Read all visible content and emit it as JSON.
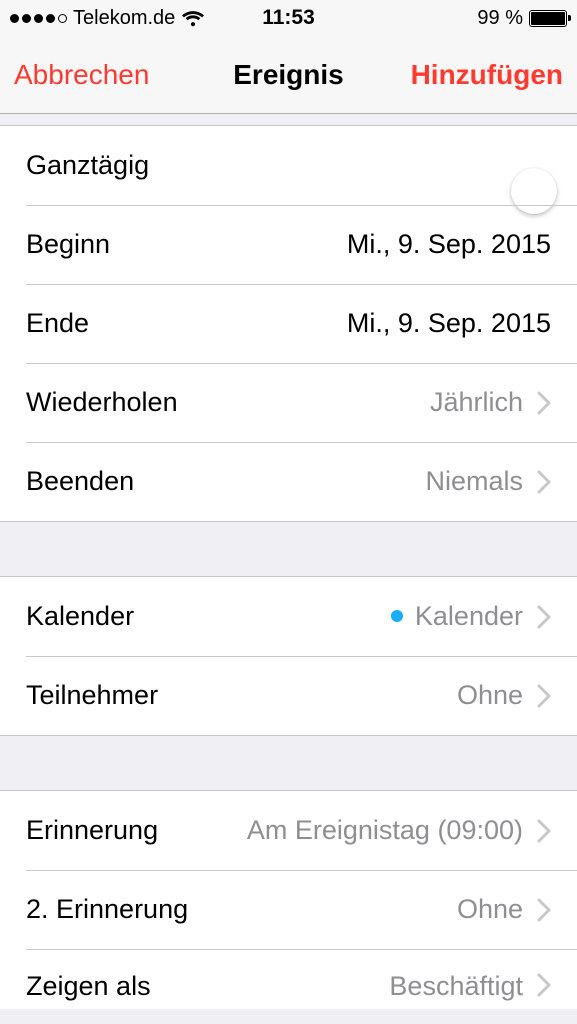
{
  "statusbar": {
    "carrier": "Telekom.de",
    "time": "11:53",
    "battery_text": "99 %",
    "battery_pct": 99,
    "signal_filled": 4,
    "signal_total": 5
  },
  "navbar": {
    "cancel": "Abbrechen",
    "title": "Ereignis",
    "add": "Hinzufügen"
  },
  "group1": {
    "allday_label": "Ganztägig",
    "allday_on": true,
    "begin_label": "Beginn",
    "begin_value": "Mi., 9. Sep. 2015",
    "end_label": "Ende",
    "end_value": "Mi., 9. Sep. 2015",
    "repeat_label": "Wiederholen",
    "repeat_value": "Jährlich",
    "stop_label": "Beenden",
    "stop_value": "Niemals"
  },
  "group2": {
    "calendar_label": "Kalender",
    "calendar_value": "Kalender",
    "calendar_dot_color": "#1badf8",
    "invitees_label": "Teilnehmer",
    "invitees_value": "Ohne"
  },
  "group3": {
    "alert_label": "Erinnerung",
    "alert_value": "Am Ereignistag (09:00)",
    "alert2_label": "2. Erinnerung",
    "alert2_value": "Ohne",
    "showas_label": "Zeigen als",
    "showas_value": "Beschäftigt"
  },
  "colors": {
    "accent_red": "#ff3b30",
    "toggle_green": "#4cd964",
    "secondary_text": "#8e8e93"
  }
}
